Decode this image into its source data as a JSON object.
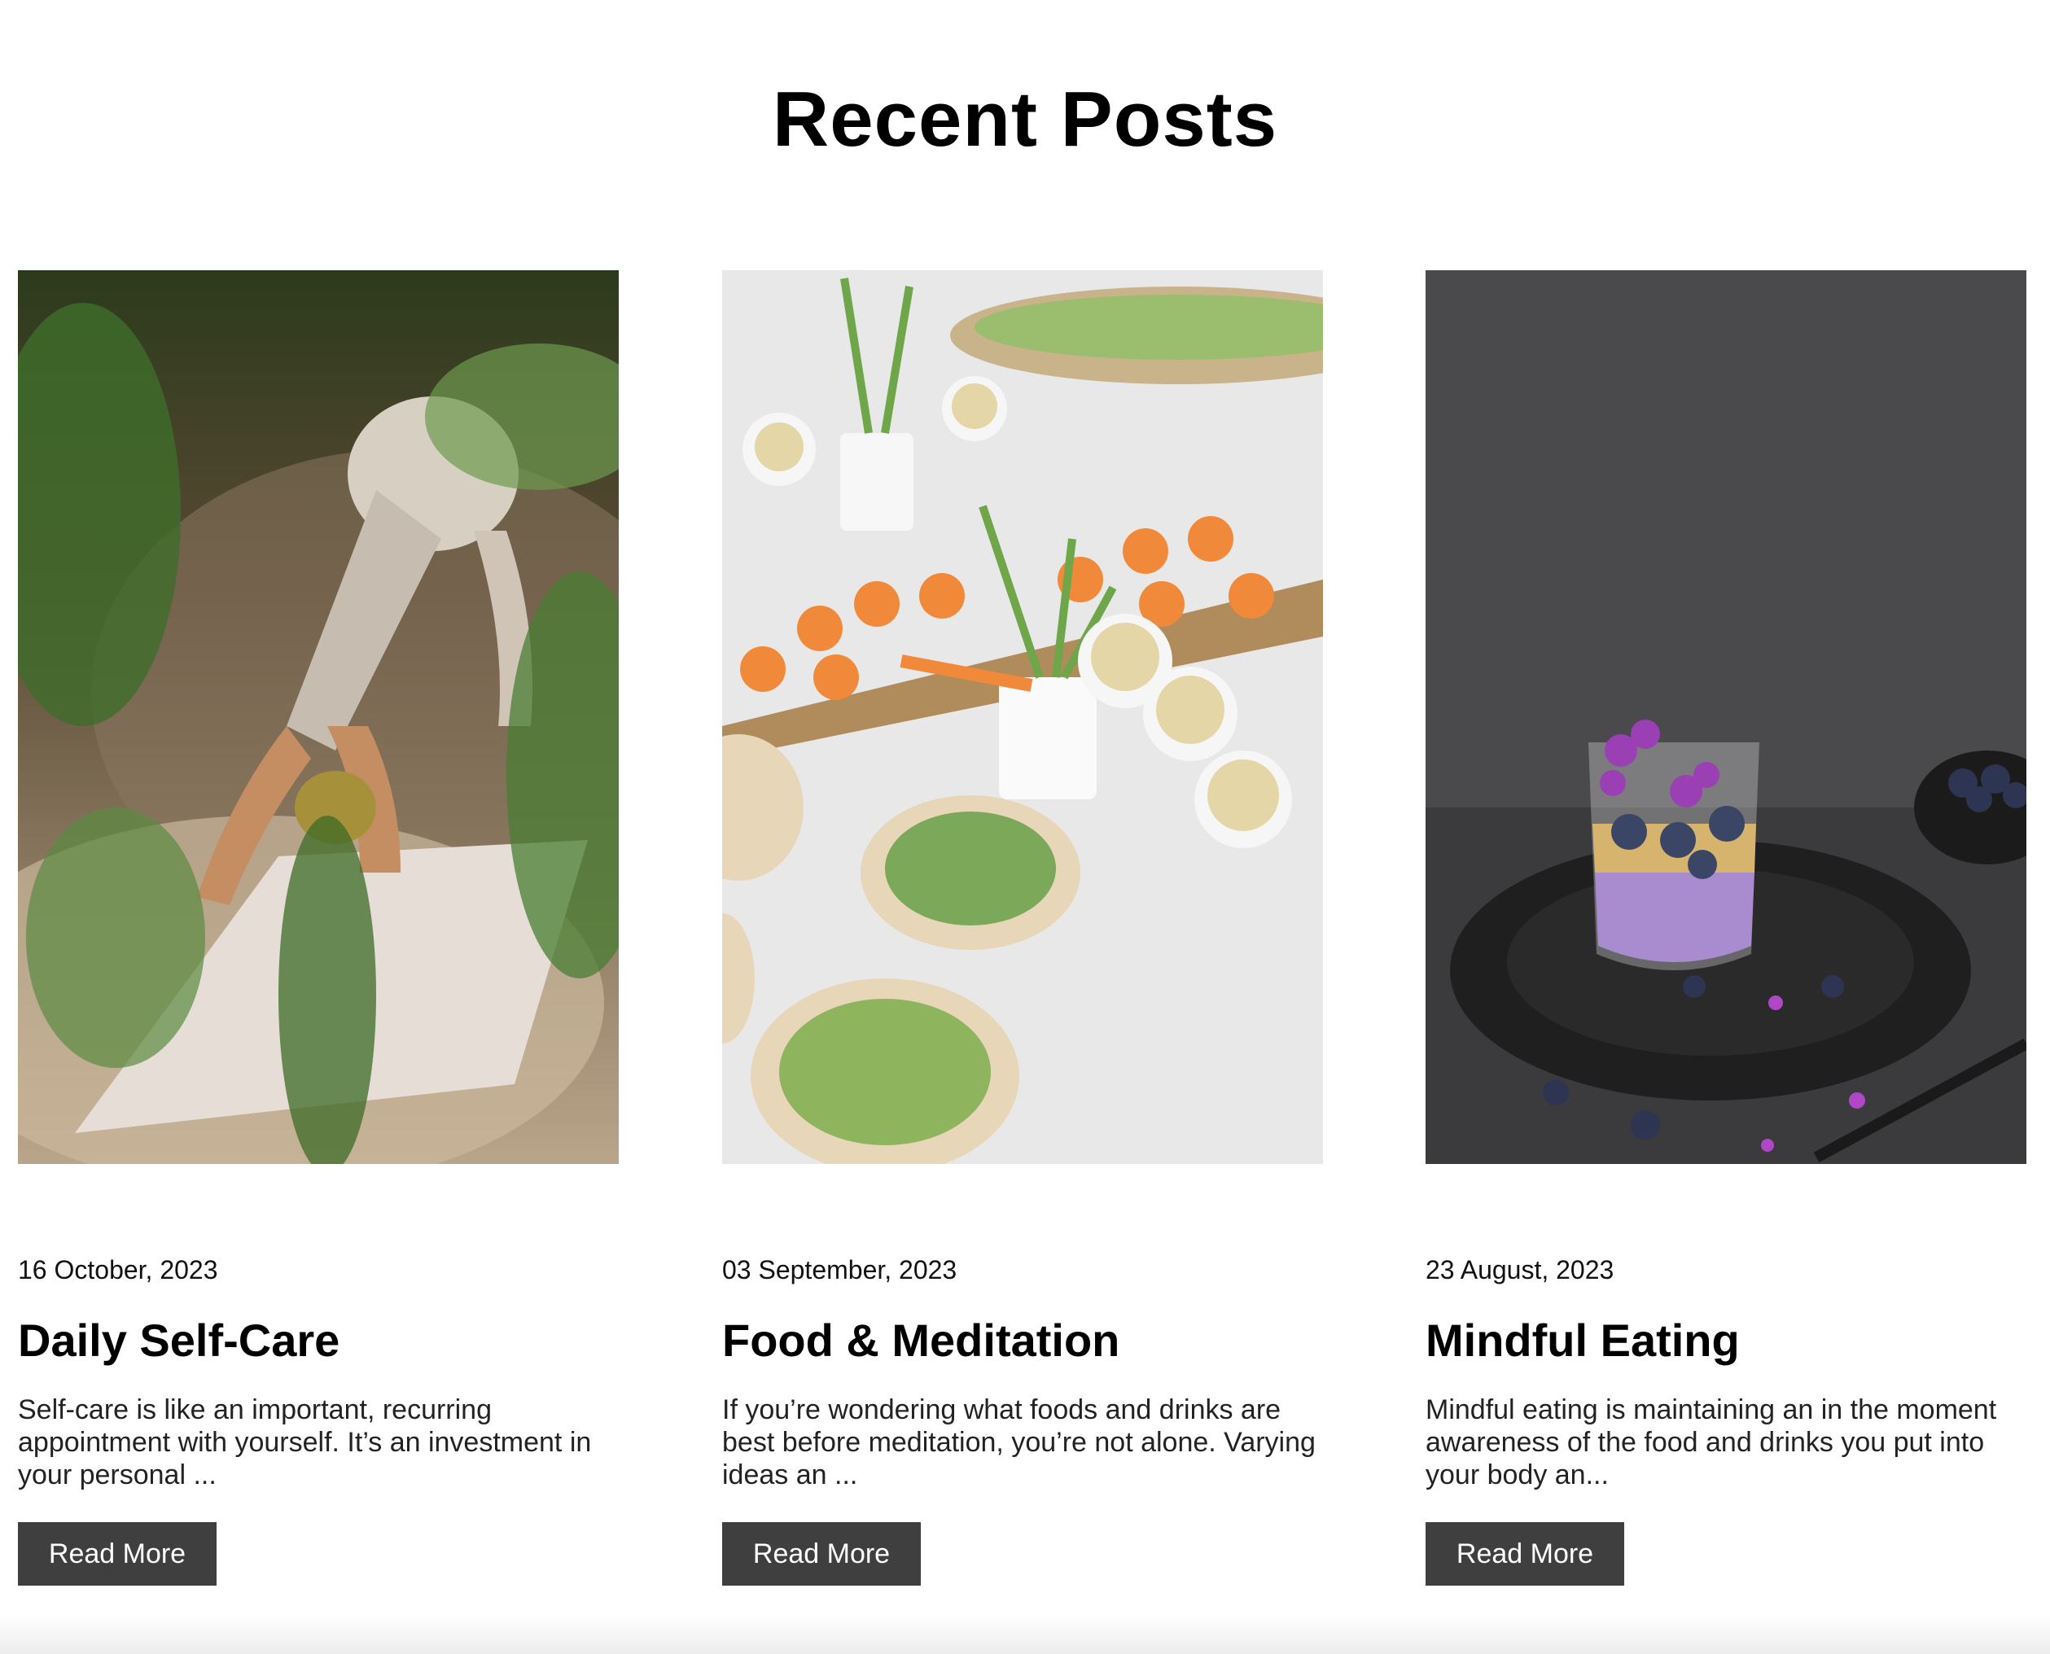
{
  "section": {
    "title": "Recent Posts"
  },
  "posts": [
    {
      "date": "16 October, 2023",
      "title": "Daily Self-Care",
      "excerpt": "Self-care is like an important, recurring appointment with yourself. It’s an investment in your personal ...",
      "button_label": "Read More",
      "image_icon": "yoga-photo"
    },
    {
      "date": "03 September, 2023",
      "title": "Food & Meditation",
      "excerpt": "If you’re wondering what foods and drinks are best before meditation, you’re not alone. Varying ideas an ...",
      "button_label": "Read More",
      "image_icon": "appetizer-table-photo"
    },
    {
      "date": "23 August, 2023",
      "title": "Mindful Eating",
      "excerpt": "Mindful eating is maintaining an in the moment awareness of the food and drinks you put into your body an...",
      "button_label": "Read More",
      "image_icon": "blueberry-parfait-photo"
    }
  ],
  "colors": {
    "button_bg": "#3f3f3f",
    "button_text": "#ffffff",
    "background": "#ffffff"
  }
}
